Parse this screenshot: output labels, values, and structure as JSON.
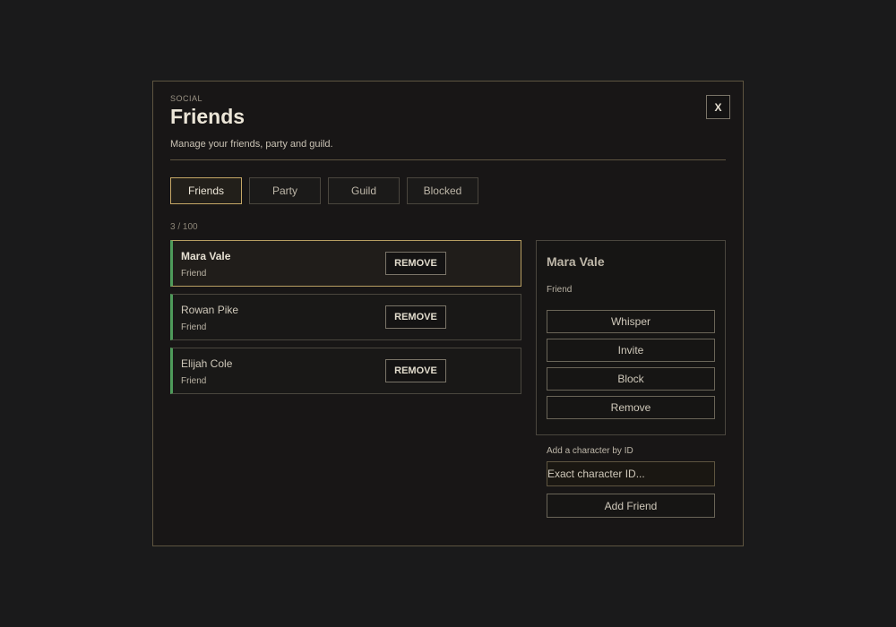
{
  "header": {
    "overline": "SOCIAL",
    "title": "Friends",
    "subtitle": "Manage your friends, party and guild.",
    "close_label": "X"
  },
  "tabs": [
    {
      "label": "Friends",
      "active": true
    },
    {
      "label": "Party",
      "active": false
    },
    {
      "label": "Guild",
      "active": false
    },
    {
      "label": "Blocked",
      "active": false
    }
  ],
  "count": "3 / 100",
  "friends": [
    {
      "name": "Mara Vale",
      "status": "Friend",
      "remove_label": "REMOVE",
      "selected": true
    },
    {
      "name": "Rowan Pike",
      "status": "Friend",
      "remove_label": "REMOVE",
      "selected": false
    },
    {
      "name": "Elijah Cole",
      "status": "Friend",
      "remove_label": "REMOVE",
      "selected": false
    }
  ],
  "detail": {
    "name": "Mara Vale",
    "status": "Friend",
    "actions": [
      "Whisper",
      "Invite",
      "Block",
      "Remove"
    ]
  },
  "add_friend": {
    "label": "Add a character by ID",
    "placeholder": "Exact character ID...",
    "button_label": "Add Friend"
  },
  "colors": {
    "accent_gold": "#c6a766",
    "online_green": "#4e9a5a",
    "background": "#1a1a1b"
  }
}
